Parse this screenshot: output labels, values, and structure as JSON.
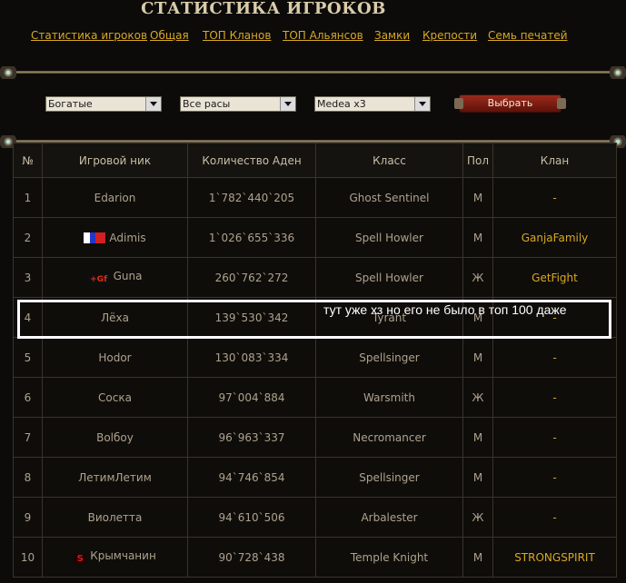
{
  "title": "СТАТИСТИКА ИГРОКОВ",
  "nav": [
    "Статистика игроков",
    "Общая",
    "ТОП Кланов",
    "ТОП Альянсов",
    "Замки",
    "Крепости",
    "Семь печатей"
  ],
  "filters": {
    "category": "Богатые",
    "race": "Все расы",
    "server": "Medea x3",
    "submit_label": "Выбрать"
  },
  "table": {
    "headers": [
      "№",
      "Игровой ник",
      "Количество Аден",
      "Класс",
      "Пол",
      "Клан"
    ],
    "rows": [
      {
        "num": "1",
        "nick": "Edarion",
        "adena": "1`782`440`205",
        "class": "Ghost Sentinel",
        "sex": "М",
        "clan": "-"
      },
      {
        "num": "2",
        "nick": "Adimis",
        "adena": "1`026`655`336",
        "class": "Spell Howler",
        "sex": "М",
        "clan": "GanjaFamily"
      },
      {
        "num": "3",
        "nick": "Guna",
        "adena": "260`762`272",
        "class": "Spell Howler",
        "sex": "Ж",
        "clan": "GetFight"
      },
      {
        "num": "4",
        "nick": "Лёха",
        "adena": "139`530`342",
        "class": "Tyrant",
        "sex": "М",
        "clan": "-"
      },
      {
        "num": "5",
        "nick": "Hodor",
        "adena": "130`083`334",
        "class": "Spellsinger",
        "sex": "М",
        "clan": "-"
      },
      {
        "num": "6",
        "nick": "Соска",
        "adena": "97`004`884",
        "class": "Warsmith",
        "sex": "Ж",
        "clan": "-"
      },
      {
        "num": "7",
        "nick": "Bolбoy",
        "adena": "96`963`337",
        "class": "Necromancer",
        "sex": "М",
        "clan": "-"
      },
      {
        "num": "8",
        "nick": "ЛетимЛетим",
        "adena": "94`746`854",
        "class": "Spellsinger",
        "sex": "М",
        "clan": "-"
      },
      {
        "num": "9",
        "nick": "Виолетта",
        "adena": "94`610`506",
        "class": "Arbalester",
        "sex": "Ж",
        "clan": "-"
      },
      {
        "num": "10",
        "nick": "Крымчанин",
        "adena": "90`728`438",
        "class": "Temple Knight",
        "sex": "М",
        "clan": "STRONGSPIRIT"
      }
    ]
  },
  "emblems": {
    "guna_text": "+Gf",
    "krym_text": "S"
  },
  "annotation": "тут уже хз но его не было в топ 100 даже"
}
